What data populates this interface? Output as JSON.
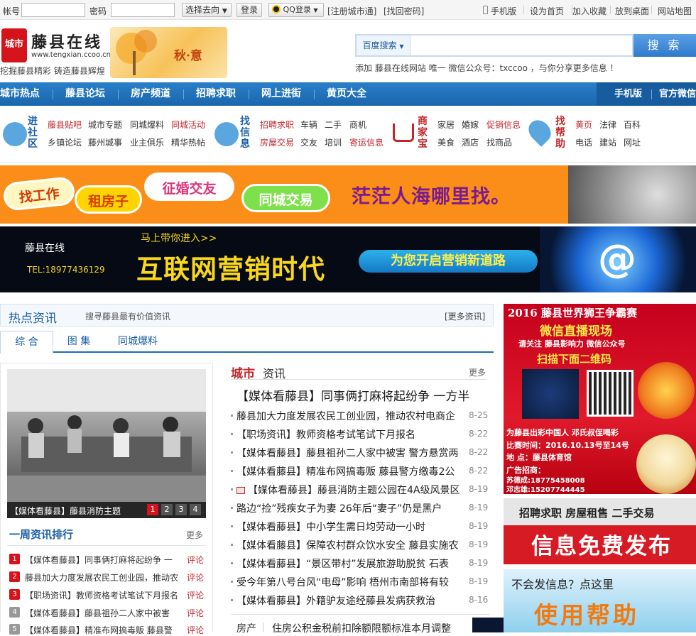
{
  "topbar": {
    "account_label": "帐号",
    "password_label": "密码",
    "goto_select": "选择去向",
    "login_button": "登录",
    "qq_login": "QQ登录",
    "register_link": "[注册城市通]",
    "forgot_link": "[找回密码]",
    "mobile_link": "手机版",
    "homepage_link": "设为首页",
    "favorite_link": "加入收藏",
    "desktop_link": "放到桌面",
    "sitemap_link": "网站地图"
  },
  "header": {
    "logo_text": "城市",
    "site_name": "藤县在线",
    "site_url": "www.tengxian.ccoo.cn",
    "slogan": "挖掘藤县精彩 铸造藤县辉煌",
    "banner_text": "秋·意",
    "search_category": "百度搜索",
    "search_value": "",
    "search_button": "搜 索",
    "search_tip": "添加 藤县在线网站 唯一 微信公众号：txccoo ，与你分享更多信息 ！"
  },
  "nav": {
    "items": [
      "城市热点",
      "藤县论坛",
      "房产频道",
      "招聘求职",
      "网上进街",
      "黄页大全"
    ],
    "right": [
      "手机版",
      "官方微信"
    ]
  },
  "channels": {
    "community": {
      "head": "进社区",
      "links": [
        "藤县贴吧",
        "城市专题",
        "同城爆料",
        "同城活动",
        "乡镇论坛",
        "藤州城事",
        "业主俱乐",
        "精华热帖"
      ]
    },
    "info": {
      "head": "找信息",
      "links": [
        "招聘求职",
        "车辆",
        "二手",
        "商机",
        "房屋交易",
        "交友",
        "培训",
        "寄运信息"
      ]
    },
    "shop": {
      "head": "商家宝",
      "links": [
        "家居",
        "婚嫁",
        "促销信息",
        "美食",
        "酒店",
        "找商品"
      ]
    },
    "help": {
      "head": "找帮助",
      "links": [
        "黄页",
        "法律",
        "百科",
        "电话",
        "建站",
        "网址"
      ]
    }
  },
  "banner1": {
    "pills": [
      "找工作",
      "租房子",
      "征婚交友",
      "同城交易"
    ],
    "slogan": "茫茫人海哪里找。"
  },
  "banner2": {
    "site": "藤县在线",
    "tel": "TEL:18977436129",
    "enter": "马上带你进入>>",
    "big": "互联网营销时代",
    "road": "为您开启营销新道路",
    "at": "@"
  },
  "hot": {
    "title": "热点资讯",
    "subtitle": "搜寻藤县最有价值资讯",
    "more": "[更多资讯]",
    "tabs": [
      "综 合",
      "图 集",
      "同城爆料"
    ]
  },
  "slideshow": {
    "caption": "【媒体看藤县】藤县消防主题",
    "pages": [
      "1",
      "2",
      "3",
      "4"
    ]
  },
  "weekly": {
    "title": "一周资讯排行",
    "more": "更多",
    "comment": "评论",
    "items": [
      "【媒体看藤县】同事俩打麻将起纷争 一",
      "藤县加大力度发展农民工创业园，推动农",
      "【职场资讯】教师资格考试笔试下月报名",
      "【媒体看藤县】藤县祖孙二人家中被害",
      "【媒体看藤县】精准布网搞毒贩 藤县警"
    ]
  },
  "city": {
    "title_red": "城市",
    "title_black": "资讯",
    "more": "更多",
    "headline": "【媒体看藤县】同事俩打麻将起纷争 一方半",
    "news": [
      {
        "t": "藤县加大力度发展农民工创业园，推动农村电商企",
        "d": "8-25",
        "img": false
      },
      {
        "t": "【职场资讯】教师资格考试笔试下月报名",
        "d": "8-22",
        "img": false
      },
      {
        "t": "【媒体看藤县】藤县祖孙二人家中被害 警方悬赏两",
        "d": "8-22",
        "img": false
      },
      {
        "t": "【媒体看藤县】精准布网搞毒贩 藤县警方缴毒2公",
        "d": "8-22",
        "img": false
      },
      {
        "t": "【媒体看藤县】藤县消防主题公园在4A级风景区",
        "d": "8-19",
        "img": true
      },
      {
        "t": "路边“捡”残疾女子为妻 26年后“妻子”仍是黑户",
        "d": "8-19",
        "img": false
      },
      {
        "t": "【媒体看藤县】中小学生需日均劳动一小时",
        "d": "8-19",
        "img": false
      },
      {
        "t": "【媒体看藤县】保障农村群众饮水安全 藤县实施农",
        "d": "8-19",
        "img": false
      },
      {
        "t": "【媒体看藤县】“景区带村”发展旅游助脱贫 石表",
        "d": "8-19",
        "img": false
      },
      {
        "t": "受今年第八号台风“电母”影响 梧州市南部将有较",
        "d": "8-19",
        "img": false
      },
      {
        "t": "【媒体看藤县】外籍驴友途经藤县发病获救治",
        "d": "8-16",
        "img": false
      }
    ],
    "bottom_cat": "房产",
    "bottom_text": "住房公积金税前扣除额限额标准本月调整"
  },
  "ads": {
    "ad1": {
      "t1": "2016 藤县世界狮王争霸赛",
      "t2": "微信直播现场",
      "t3": "请关注 藤县影响力 微信公众号",
      "t4": "扫描下面二维码",
      "t5": "为藤县出彩中国人 邓氏叔侄喝彩",
      "t6": "比赛时间：2016.10.13号至14号",
      "t7": "地 点：藤县体育馆",
      "t8": "广告招商：",
      "t9": "苏德成:18775458008",
      "t10": "邓志雄:15207744445"
    },
    "ad2": {
      "t1": "招聘求职  房屋租售  二手交易",
      "t2": "信息免费发布"
    },
    "ad3": {
      "t1": "不会发信息？点这里",
      "t2": "使用帮助"
    }
  },
  "colors": {
    "nav_blue": "#1f6fb8",
    "brand_red": "#d4141a",
    "link_red": "#c1272d"
  }
}
